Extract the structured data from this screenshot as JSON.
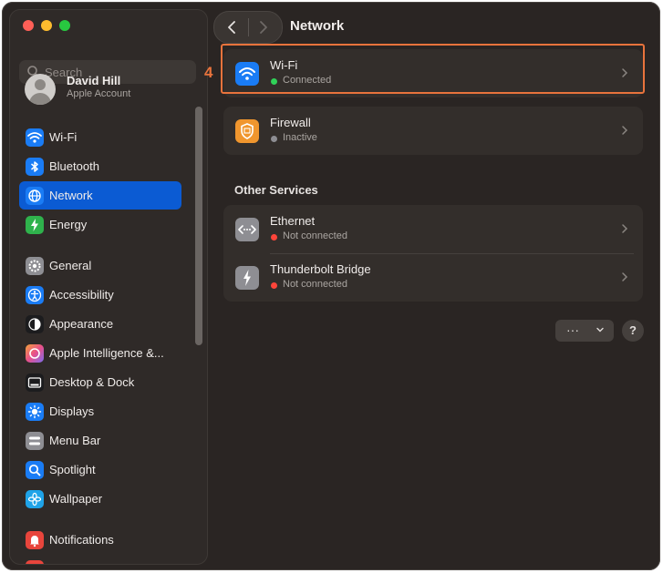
{
  "window": {
    "title": "Network"
  },
  "sidebar": {
    "search_placeholder": "Search",
    "user": {
      "name": "David Hill",
      "subtitle": "Apple Account"
    },
    "items": [
      {
        "label": "Wi-Fi",
        "icon": "wifi-icon",
        "color": "#1a7cf5"
      },
      {
        "label": "Bluetooth",
        "icon": "bluetooth-icon",
        "color": "#1a7cf5"
      },
      {
        "label": "Network",
        "icon": "globe-icon",
        "color": "#1a7cf5",
        "selected": true
      },
      {
        "label": "Energy",
        "icon": "bolt-icon",
        "color": "#2fb24c"
      },
      {
        "label": "General",
        "icon": "gear-icon",
        "color": "#8e8e93"
      },
      {
        "label": "Accessibility",
        "icon": "accessibility-icon",
        "color": "#1a7cf5"
      },
      {
        "label": "Appearance",
        "icon": "appearance-icon",
        "color": "#1c1c1e"
      },
      {
        "label": "Apple Intelligence &...",
        "icon": "apple-intelligence-icon",
        "color": "#e86a8a"
      },
      {
        "label": "Desktop & Dock",
        "icon": "dock-icon",
        "color": "#1c1c1e"
      },
      {
        "label": "Displays",
        "icon": "sun-icon",
        "color": "#1a7cf5"
      },
      {
        "label": "Menu Bar",
        "icon": "menubar-icon",
        "color": "#8e8e93"
      },
      {
        "label": "Spotlight",
        "icon": "magnifier-icon",
        "color": "#1a7cf5"
      },
      {
        "label": "Wallpaper",
        "icon": "flower-icon",
        "color": "#1fa3e8"
      },
      {
        "label": "Notifications",
        "icon": "bell-icon",
        "color": "#e8453c"
      }
    ]
  },
  "main": {
    "services": [
      {
        "name": "Wi-Fi",
        "status": "Connected",
        "status_color": "#30d158",
        "icon": "wifi-icon",
        "icon_color": "#1a7cf5"
      },
      {
        "name": "Firewall",
        "status": "Inactive",
        "status_color": "#8e8e93",
        "icon": "firewall-icon",
        "icon_color": "#f0962e"
      }
    ],
    "other_services_heading": "Other Services",
    "other_services": [
      {
        "name": "Ethernet",
        "status": "Not connected",
        "status_color": "#ff453a",
        "icon": "ethernet-icon",
        "icon_color": "#8e8e93"
      },
      {
        "name": "Thunderbolt Bridge",
        "status": "Not connected",
        "status_color": "#ff453a",
        "icon": "thunderbolt-icon",
        "icon_color": "#8e8e93"
      }
    ],
    "more_button": "···",
    "help_button": "?"
  },
  "annotation": {
    "marker": "4",
    "color": "#e8733c"
  }
}
